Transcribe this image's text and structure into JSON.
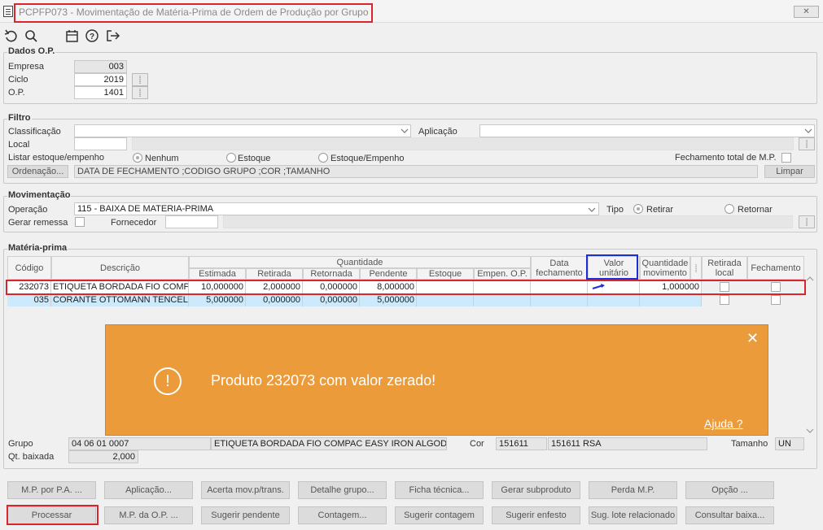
{
  "window": {
    "title": "PCPFP073 - Movimentação de Matéria-Prima de Ordem de Produção por Grupo",
    "close_glyph": "✕"
  },
  "toolbar": {
    "icons": [
      "undo-icon",
      "search-icon",
      "calendar-icon",
      "help-icon",
      "exit-icon"
    ]
  },
  "dados_op": {
    "legend": "Dados O.P.",
    "empresa_label": "Empresa",
    "empresa": "003",
    "ciclo_label": "Ciclo",
    "ciclo": "2019",
    "op_label": "O.P.",
    "op": "1401",
    "pick_glyph": "⸽"
  },
  "filtro": {
    "legend": "Filtro",
    "classificacao_label": "Classificação",
    "classificacao": "",
    "aplicacao_label": "Aplicação",
    "aplicacao": "",
    "local_label": "Local",
    "local": "",
    "listar_label": "Listar estoque/empenho",
    "radio_nenhum": "Nenhum",
    "radio_estoque": "Estoque",
    "radio_estoque_empenho": "Estoque/Empenho",
    "selected": "Nenhum",
    "fechamento_total_label": "Fechamento total de M.P.",
    "ordenacao_button": "Ordenação...",
    "ordenacao_value": "DATA DE FECHAMENTO ;CODIGO GRUPO ;COR ;TAMANHO",
    "limpar_button": "Limpar"
  },
  "movimentacao": {
    "legend": "Movimentação",
    "operacao_label": "Operação",
    "operacao": "115 - BAIXA DE MATERIA-PRIMA",
    "tipo_label": "Tipo",
    "tipo_retirar": "Retirar",
    "tipo_retornar": "Retornar",
    "tipo_selected": "Retirar",
    "gerar_remessa_label": "Gerar remessa",
    "fornecedor_label": "Fornecedor",
    "fornecedor": ""
  },
  "materia_prima": {
    "legend": "Matéria-prima",
    "headers": {
      "codigo": "Código",
      "descricao": "Descrição",
      "quantidade": "Quantidade",
      "estimada": "Estimada",
      "retirada": "Retirada",
      "retornada": "Retornada",
      "pendente": "Pendente",
      "estoque": "Estoque",
      "empen_op": "Empen. O.P.",
      "data_fech": "Data fechamento",
      "valor_unit": "Valor unitário",
      "qtd_mov": "Quantidade movimento",
      "retirada_local": "Retirada local",
      "fechamento": "Fechamento"
    },
    "rows": [
      {
        "codigo": "232073",
        "descricao": "ETIQUETA BORDADA FIO COMPAC",
        "estimada": "10,000000",
        "retirada": "2,000000",
        "retornada": "0,000000",
        "pendente": "8,000000",
        "estoque": "",
        "empen": "",
        "data": "",
        "valor": "",
        "qtd_mov": "1,000000"
      },
      {
        "codigo": "035",
        "descricao": "CORANTE OTTOMANN TENCEL CO",
        "estimada": "5,000000",
        "retirada": "0,000000",
        "retornada": "0,000000",
        "pendente": "5,000000",
        "estoque": "",
        "empen": "",
        "data": "",
        "valor": "",
        "qtd_mov": ""
      }
    ]
  },
  "alert": {
    "message": "Produto 232073 com valor zerado!",
    "help_link": "Ajuda ?",
    "color": "#ec9b3b",
    "close_glyph": "✕",
    "icon_glyph": "!"
  },
  "footer": {
    "grupo_label": "Grupo",
    "grupo_code": "04 06 01 0007",
    "grupo_desc": "ETIQUETA BORDADA FIO COMPAC EASY IRON ALGODAO",
    "cor_label": "Cor",
    "cor_code": "151611",
    "cor_desc": "151611 RSA",
    "tamanho_label": "Tamanho",
    "tamanho": "UN",
    "qt_baixada_label": "Qt. baixada",
    "qt_baixada": "2,000"
  },
  "buttons": {
    "row1": [
      "M.P. por P.A. ...",
      "Aplicação...",
      "Acerta mov.p/trans.",
      "Detalhe grupo...",
      "Ficha técnica...",
      "Gerar subproduto",
      "Perda M.P.",
      "Opção ..."
    ],
    "row2": [
      "Processar",
      "M.P. da O.P. ...",
      "Sugerir pendente",
      "Contagem...",
      "Sugerir contagem",
      "Sugerir enfesto",
      "Sug. lote relacionado",
      "Consultar baixa..."
    ]
  },
  "colors": {
    "highlight_red": "#d9262c",
    "highlight_blue": "#1b2fd6",
    "selected_row": "#cdeafc"
  }
}
